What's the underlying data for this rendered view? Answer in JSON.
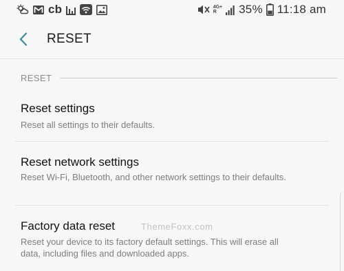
{
  "status_bar": {
    "icons_left": [
      "weather-icon",
      "gmail-icon",
      "cb-icon",
      "meter-icon",
      "wifi-icon",
      "gallery-icon"
    ],
    "cb_label": "cb",
    "network_top": "4G+",
    "network_bottom": "R",
    "battery_percent": "35%",
    "time": "11:18 am"
  },
  "app_bar": {
    "title": "RESET"
  },
  "section": {
    "title": "RESET"
  },
  "items": [
    {
      "title": "Reset settings",
      "subtitle": "Reset all settings to their defaults."
    },
    {
      "title": "Reset network settings",
      "subtitle": "Reset Wi-Fi, Bluetooth, and other network settings to their defaults."
    },
    {
      "title": "Factory data reset",
      "subtitle": "Reset your device to its factory default settings. This will erase all data, including files and downloaded apps."
    }
  ],
  "watermark": "ThemeFoxx.com",
  "colors": {
    "accent": "#3c8b9a",
    "background": "#f7f7f7",
    "primary_text": "#111111",
    "secondary_text": "#7d7d7d"
  }
}
